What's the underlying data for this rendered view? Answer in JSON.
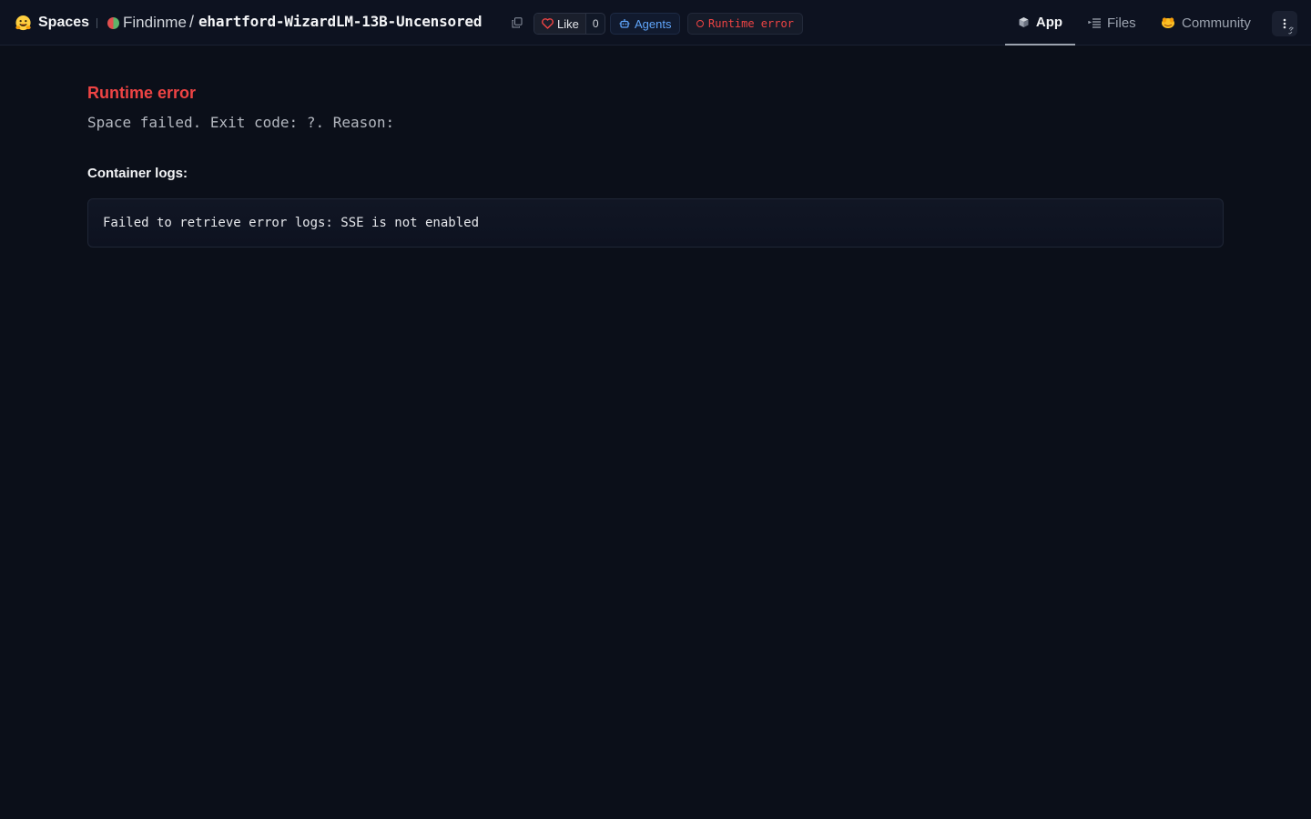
{
  "header": {
    "brand": "Spaces",
    "owner": "Findinme",
    "separator": "/",
    "repo": "ehartford-WizardLM-13B-Uncensored",
    "like_label": "Like",
    "like_count": "0",
    "agents_label": "Agents",
    "status_label": "Runtime error"
  },
  "tabs": [
    {
      "label": "App",
      "icon": "cube-icon",
      "active": true
    },
    {
      "label": "Files",
      "icon": "files-icon",
      "active": false
    },
    {
      "label": "Community",
      "icon": "community-icon",
      "active": false
    }
  ],
  "main": {
    "error_title": "Runtime error",
    "error_message": "Space failed. Exit code: ?. Reason:",
    "logs_title": "Container logs:",
    "logs_text": "Failed to retrieve error logs: SSE is not enabled"
  },
  "colors": {
    "background": "#0b0f19",
    "error": "#ef4444",
    "link": "#60a5fa"
  }
}
